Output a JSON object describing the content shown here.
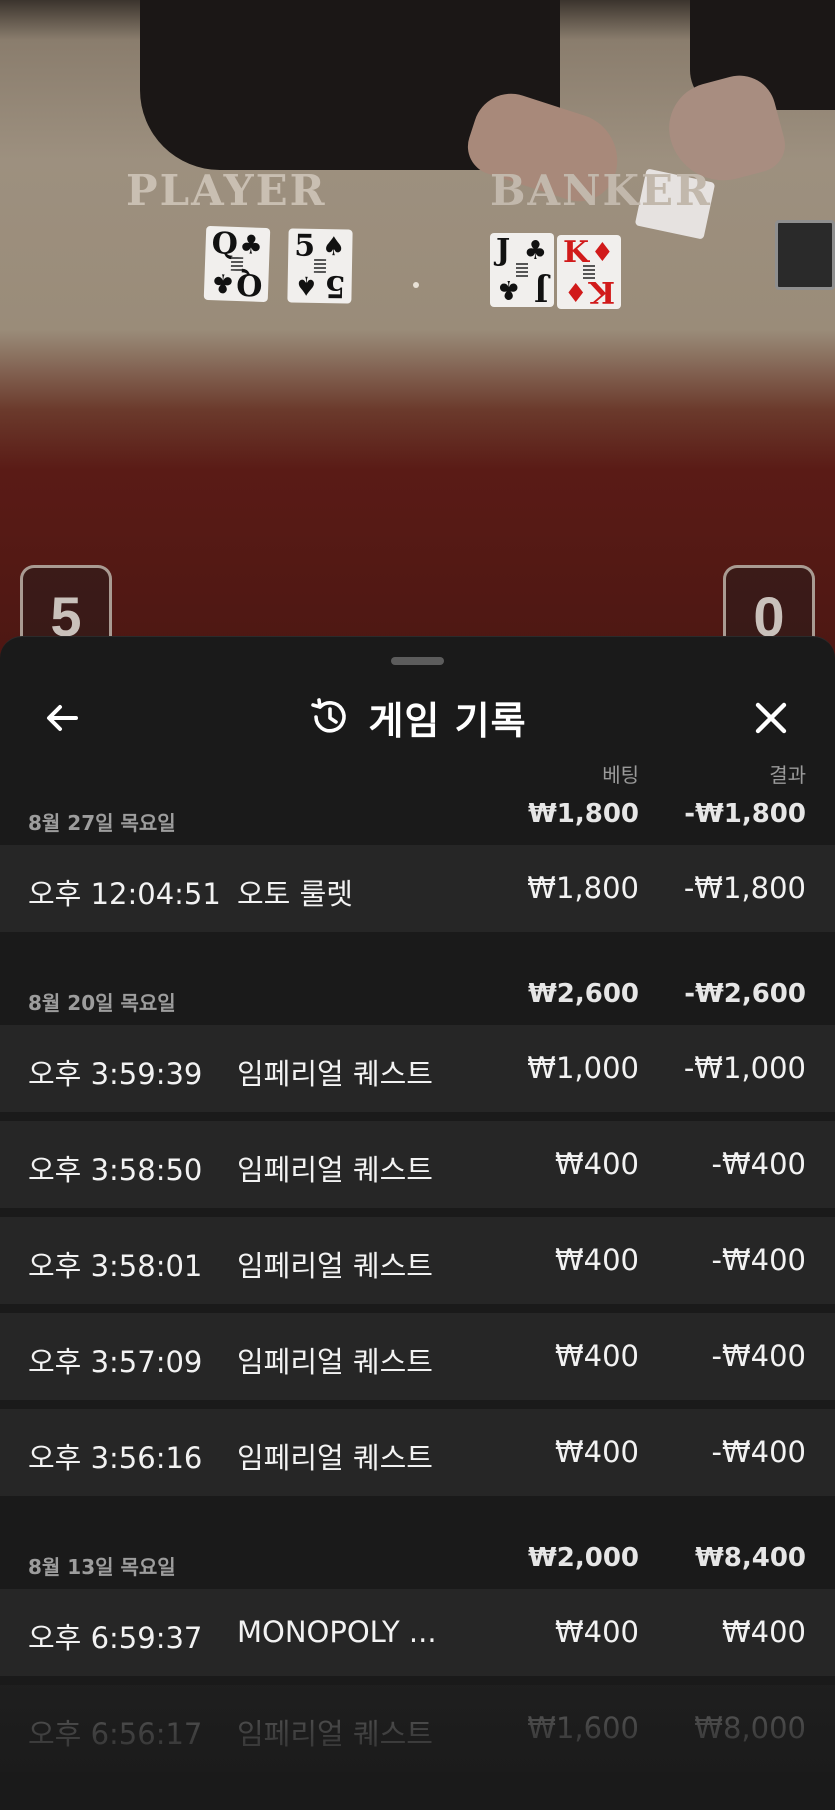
{
  "table": {
    "player_label": "PLAYER",
    "banker_label": "BANKER",
    "player_score": "5",
    "banker_score": "0",
    "player_cards": [
      {
        "rank": "Q",
        "suit": "♣",
        "color": "black"
      },
      {
        "rank": "5",
        "suit": "♠",
        "color": "black"
      }
    ],
    "banker_cards": [
      {
        "rank": "J",
        "suit": "♣",
        "color": "black"
      },
      {
        "rank": "K",
        "suit": "♦",
        "color": "red"
      }
    ]
  },
  "sheet": {
    "title": "게임 기록",
    "icons": {
      "back": "back-arrow-icon",
      "history": "history-icon",
      "close": "close-icon"
    },
    "columns": {
      "bet": "베팅",
      "result": "결과"
    },
    "groups": [
      {
        "date": "8월 27일 목요일",
        "bet_total": "₩1,800",
        "result_total": "-₩1,800",
        "rows": [
          {
            "time": "오후 12:04:51",
            "game": "오토 룰렛",
            "bet": "₩1,800",
            "result": "-₩1,800"
          }
        ]
      },
      {
        "date": "8월 20일 목요일",
        "bet_total": "₩2,600",
        "result_total": "-₩2,600",
        "rows": [
          {
            "time": "오후 3:59:39",
            "game": "임페리얼 퀘스트",
            "bet": "₩1,000",
            "result": "-₩1,000"
          },
          {
            "time": "오후 3:58:50",
            "game": "임페리얼 퀘스트",
            "bet": "₩400",
            "result": "-₩400"
          },
          {
            "time": "오후 3:58:01",
            "game": "임페리얼 퀘스트",
            "bet": "₩400",
            "result": "-₩400"
          },
          {
            "time": "오후 3:57:09",
            "game": "임페리얼 퀘스트",
            "bet": "₩400",
            "result": "-₩400"
          },
          {
            "time": "오후 3:56:16",
            "game": "임페리얼 퀘스트",
            "bet": "₩400",
            "result": "-₩400"
          }
        ]
      },
      {
        "date": "8월 13일 목요일",
        "bet_total": "₩2,000",
        "result_total": "₩8,400",
        "rows": [
          {
            "time": "오후 6:59:37",
            "game": "MONOPOLY ...",
            "bet": "₩400",
            "result": "₩400"
          },
          {
            "time": "오후 6:56:17",
            "game": "임페리얼 퀘스트",
            "bet": "₩1,600",
            "result": "₩8,000"
          }
        ]
      }
    ]
  }
}
